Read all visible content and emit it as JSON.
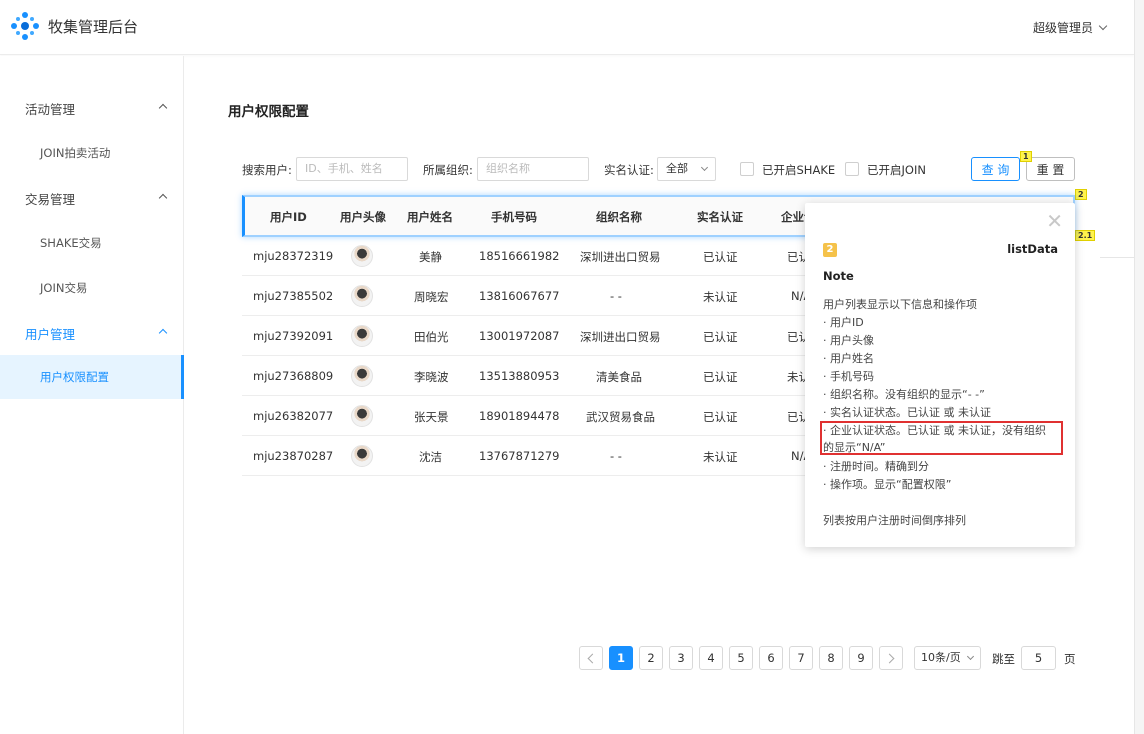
{
  "header": {
    "title": "牧集管理后台",
    "user": "超级管理员"
  },
  "sidebar": {
    "groups": [
      {
        "label": "活动管理",
        "items": [
          "JOIN拍卖活动"
        ]
      },
      {
        "label": "交易管理",
        "items": [
          "SHAKE交易",
          "JOIN交易"
        ]
      },
      {
        "label": "用户管理",
        "items": [
          "用户权限配置"
        ]
      }
    ]
  },
  "page": {
    "title": "用户权限配置"
  },
  "filters": {
    "search_label": "搜索用户:",
    "search_placeholder": "ID、手机、姓名",
    "org_label": "所属组织:",
    "org_placeholder": "组织名称",
    "verify_label": "实名认证:",
    "verify_value": "全部",
    "shake_label": "已开启SHAKE",
    "join_label": "已开启JOIN",
    "query_button": "查 询",
    "reset_button": "重 置",
    "marker_1": "1"
  },
  "markers": {
    "m2": "2",
    "m21": "2.1"
  },
  "table": {
    "columns": [
      "用户ID",
      "用户头像",
      "用户姓名",
      "手机号码",
      "组织名称",
      "实名认证",
      "企业认"
    ],
    "rows": [
      {
        "id": "mju28372319",
        "name": "美静",
        "phone": "18516661982",
        "org": "深圳进出口贸易",
        "verified": "已认证",
        "company": "已认"
      },
      {
        "id": "mju27385502",
        "name": "周晓宏",
        "phone": "13816067677",
        "org": "- -",
        "verified": "未认证",
        "company": "N/A"
      },
      {
        "id": "mju27392091",
        "name": "田伯光",
        "phone": "13001972087",
        "org": "深圳进出口贸易",
        "verified": "已认证",
        "company": "已认"
      },
      {
        "id": "mju27368809",
        "name": "李晓波",
        "phone": "13513880953",
        "org": "清美食品",
        "verified": "已认证",
        "company": "未认"
      },
      {
        "id": "mju26382077",
        "name": "张天景",
        "phone": "18901894478",
        "org": "武汉贸易食品",
        "verified": "已认证",
        "company": "已认"
      },
      {
        "id": "mju23870287",
        "name": "沈洁",
        "phone": "13767871279",
        "org": "- -",
        "verified": "未认证",
        "company": "N/A"
      }
    ]
  },
  "note": {
    "badge": "2",
    "list_name": "listData",
    "title": "Note",
    "close": "✕",
    "lines": [
      "用户列表显示以下信息和操作项",
      "· 用户ID",
      "· 用户头像",
      "· 用户姓名",
      "· 手机号码",
      "· 组织名称。没有组织的显示“- -”",
      "· 实名认证状态。已认证 或 未认证",
      "· 企业认证状态。已认证 或 未认证，没有组织",
      "的显示“N/A”",
      "· 注册时间。精确到分",
      "· 操作项。显示“配置权限”",
      "",
      "列表按用户注册时间倒序排列"
    ]
  },
  "pagination": {
    "pages": [
      "1",
      "2",
      "3",
      "4",
      "5",
      "6",
      "7",
      "8",
      "9"
    ],
    "current": "1",
    "page_size": "10条/页",
    "jump_label": "跳至",
    "jump_value": "5",
    "page_unit": "页"
  }
}
